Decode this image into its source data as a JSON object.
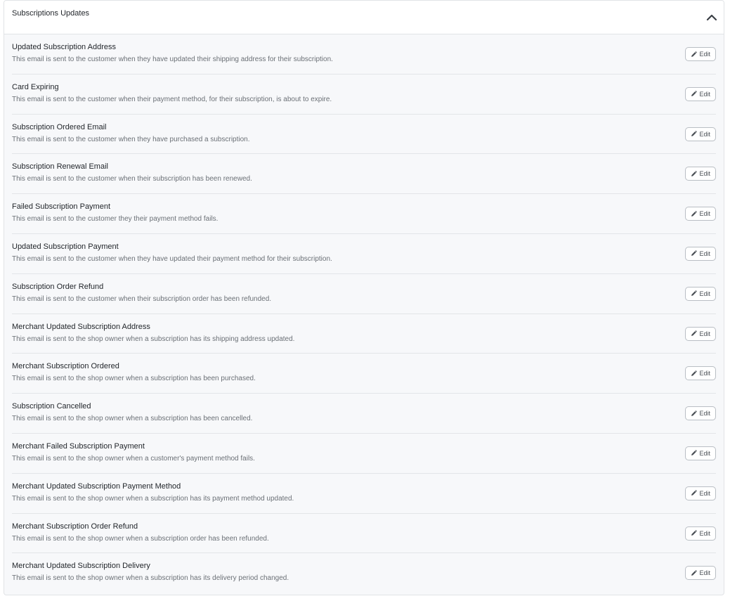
{
  "panel": {
    "title": "Subscriptions Updates",
    "toggle_icon": "chevron-up-icon"
  },
  "rows": [
    {
      "title": "Updated Subscription Address",
      "description": "This email is sent to the customer when they have updated their shipping address for their subscription.",
      "edit_label": "Edit"
    },
    {
      "title": "Card Expiring",
      "description": "This email is sent to the customer when their payment method, for their subscription, is about to expire.",
      "edit_label": "Edit"
    },
    {
      "title": "Subscription Ordered Email",
      "description": "This email is sent to the customer when they have purchased a subscription.",
      "edit_label": "Edit"
    },
    {
      "title": "Subscription Renewal Email",
      "description": "This email is sent to the customer when their subscription has been renewed.",
      "edit_label": "Edit"
    },
    {
      "title": "Failed Subscription Payment",
      "description": "This email is sent to the customer they their payment method fails.",
      "edit_label": "Edit"
    },
    {
      "title": "Updated Subscription Payment",
      "description": "This email is sent to the customer when they have updated their payment method for their subscription.",
      "edit_label": "Edit"
    },
    {
      "title": "Subscription Order Refund",
      "description": "This email is sent to the customer when their subscription order has been refunded.",
      "edit_label": "Edit"
    },
    {
      "title": "Merchant Updated Subscription Address",
      "description": "This email is sent to the shop owner when a subscription has its shipping address updated.",
      "edit_label": "Edit"
    },
    {
      "title": "Merchant Subscription Ordered",
      "description": "This email is sent to the shop owner when a subscription has been purchased.",
      "edit_label": "Edit"
    },
    {
      "title": "Subscription Cancelled",
      "description": "This email is sent to the shop owner when a subscription has been cancelled.",
      "edit_label": "Edit"
    },
    {
      "title": "Merchant Failed Subscription Payment",
      "description": "This email is sent to the shop owner when a customer's payment method fails.",
      "edit_label": "Edit"
    },
    {
      "title": "Merchant Updated Subscription Payment Method",
      "description": "This email is sent to the shop owner when a subscription has its payment method updated.",
      "edit_label": "Edit"
    },
    {
      "title": "Merchant Subscription Order Refund",
      "description": "This email is sent to the shop owner when a subscription order has been refunded.",
      "edit_label": "Edit"
    },
    {
      "title": "Merchant Updated Subscription Delivery",
      "description": "This email is sent to the shop owner when a subscription has its delivery period changed.",
      "edit_label": "Edit"
    }
  ],
  "colors": {
    "panel_bg": "#f7f8fa",
    "border": "#e1e3e6",
    "title_text": "#1f2328",
    "desc_text": "#6b7076"
  }
}
